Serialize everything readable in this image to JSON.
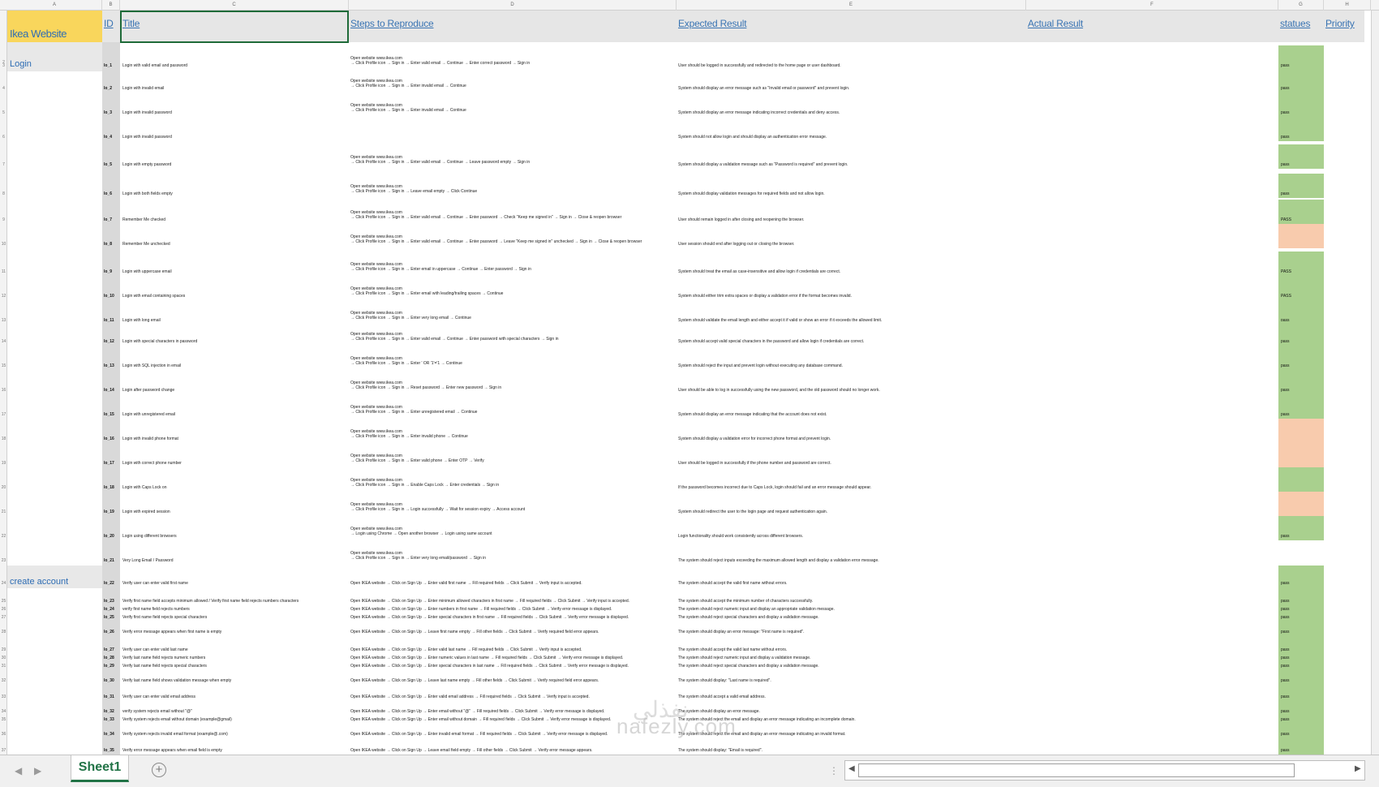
{
  "columns": {
    "letters": [
      "A",
      "B",
      "C",
      "D",
      "E",
      "F",
      "G",
      "H"
    ],
    "headers": {
      "module": "Ikea Website",
      "id": "ID",
      "title": "Title",
      "steps": "Steps to Reproduce",
      "expected": "Expected Result",
      "actual": "Actual Result",
      "status": "statues",
      "priority": "Priority"
    }
  },
  "modules": [
    "Login",
    "create account"
  ],
  "login_rows": [
    {
      "id": "lo_1",
      "title": "Login with valid email and password",
      "steps": [
        "Open website www.ikea.com",
        "→ Click Profile icon → Sign in → Enter valid email → Continue → Enter correct password → Sign in"
      ],
      "expected": "User should be logged in successfully and redirected to the home page or user dashboard.",
      "status": "pass",
      "fill": "green"
    },
    {
      "id": "lo_2",
      "title": "Login with invalid email",
      "steps": [
        "Open website www.ikea.com",
        "→ Click Profile icon → Sign in → Enter invalid email → Continue"
      ],
      "expected": "System should display an error message such as \"Invalid email or password\" and prevent login.",
      "status": "pass",
      "fill": "green"
    },
    {
      "id": "lo_3",
      "title": "Login with invalid password",
      "steps": [
        "Open website www.ikea.com",
        "→ Click Profile icon → Sign in → Enter invalid email → Continue"
      ],
      "expected": "System should display an error message indicating incorrect credentials and deny access.",
      "status": "pass",
      "fill": "green"
    },
    {
      "id": "lo_4",
      "title": "Login with invalid password",
      "steps": [
        ""
      ],
      "expected": "System should not allow login and should display an authentication error message.",
      "status": "pass",
      "fill": "green"
    },
    {
      "id": "lo_5",
      "title": "Login with empty password",
      "steps": [
        "Open website www.ikea.com",
        "→ Click Profile icon → Sign in → Enter valid email → Continue → Leave password empty → Sign in"
      ],
      "expected": "System should display a validation message such as \"Password is required\" and prevent login.",
      "status": "pass",
      "fill": "green"
    },
    {
      "id": "lo_6",
      "title": "Login with both fields empty",
      "steps": [
        "Open website www.ikea.com",
        "→ Click Profile icon → Sign in → Leave email empty → Click Continue"
      ],
      "expected": "System should display validation messages for required fields and not allow login.",
      "status": "pass",
      "fill": "green"
    },
    {
      "id": "lo_7",
      "title": "Remember Me checked",
      "steps": [
        "Open website www.ikea.com",
        "→ Click Profile icon → Sign in → Enter valid email → Continue → Enter password → Check \"Keep me signed in\" → Sign in → Close & reopen browser"
      ],
      "expected": "User should remain logged in after closing and reopening the browser.",
      "status": "PASS",
      "fill": "green"
    },
    {
      "id": "lo_8",
      "title": "Remember Me unchecked",
      "steps": [
        "Open website www.ikea.com",
        "→ Click Profile icon → Sign in → Enter valid email → Continue → Enter password → Leave \"Keep me signed in\" unchecked → Sign in → Close & reopen browser"
      ],
      "expected": "User session should end after logging out or closing the browser.",
      "status": "",
      "fill": "orange"
    },
    {
      "id": "lo_9",
      "title": "Login with uppercase email",
      "steps": [
        "Open website www.ikea.com",
        "→ Click Profile icon → Sign in → Enter email in uppercase → Continue → Enter password → Sign in"
      ],
      "expected": "System should treat the email as case-insensitive and allow login if credentials are correct.",
      "status": "PASS",
      "fill": "green"
    },
    {
      "id": "lo_10",
      "title": "Login with email containing spaces",
      "steps": [
        "Open website www.ikea.com",
        "→ Click Profile icon → Sign in → Enter email with leading/trailing spaces → Continue"
      ],
      "expected": "System should either trim extra spaces or display a validation error if the format becomes invalid.",
      "status": "PASS",
      "fill": "green"
    },
    {
      "id": "lo_11",
      "title": "Login with long email",
      "steps": [
        "Open website www.ikea.com",
        "→ Click Profile icon → Sign in → Enter very long email → Continue"
      ],
      "expected": "System should validate the email length and either accept it if valid or show an error if it exceeds the allowed limit.",
      "status": "pass",
      "fill": "green"
    },
    {
      "id": "lo_12",
      "title": "Login with special characters in password",
      "steps": [
        "Open website www.ikea.com",
        "→ Click Profile icon → Sign in → Enter valid email → Continue → Enter password with special characters → Sign in"
      ],
      "expected": "System should accept valid special characters in the password and allow login if credentials are correct.",
      "status": "pass",
      "fill": "green"
    },
    {
      "id": "lo_13",
      "title": "Login with SQL injection in email",
      "steps": [
        "Open website www.ikea.com",
        "→ Click Profile icon → Sign in → Enter ' OR '1'='1 → Continue"
      ],
      "expected": "System should reject the input and prevent login without executing any database command.",
      "status": "pass",
      "fill": "green"
    },
    {
      "id": "lo_14",
      "title": "Login after password change",
      "steps": [
        "Open website www.ikea.com",
        "→ Click Profile icon → Sign in → Reset password → Enter new password → Sign in"
      ],
      "expected": "User should be able to log in successfully using the new password, and the old password should no longer work.",
      "status": "pass",
      "fill": "green"
    },
    {
      "id": "lo_15",
      "title": "Login with unregistered email",
      "steps": [
        "Open website www.ikea.com",
        "→ Click Profile icon → Sign in → Enter unregistered email → Continue"
      ],
      "expected": "System should display an error message indicating that the account does not exist.",
      "status": "pass",
      "fill": "green"
    },
    {
      "id": "lo_16",
      "title": "Login with invalid phone format",
      "steps": [
        "Open website www.ikea.com",
        "→ Click Profile icon → Sign in → Enter invalid phone → Continue"
      ],
      "expected": "System should display a validation error for incorrect phone format and prevent login.",
      "status": "",
      "fill": "orange"
    },
    {
      "id": "lo_17",
      "title": "Login with correct phone number",
      "steps": [
        "Open website www.ikea.com",
        "→ Click Profile icon → Sign in → Enter valid phone → Enter OTP → Verify"
      ],
      "expected": "User should be logged in successfully if the phone number and password are correct.",
      "status": "",
      "fill": "orange"
    },
    {
      "id": "lo_18",
      "title": "Login with Caps Lock on",
      "steps": [
        "Open website www.ikea.com",
        "→ Click Profile icon → Sign in → Enable Caps Lock → Enter credentials → Sign in"
      ],
      "expected": "If the password becomes incorrect due to Caps Lock, login should fail and an error message should appear.",
      "status": "",
      "fill": "green"
    },
    {
      "id": "lo_19",
      "title": "Login with expired session",
      "steps": [
        "Open website www.ikea.com",
        "→ Click Profile icon → Sign in → Login successfully → Wait for session expiry → Access account"
      ],
      "expected": "System should redirect the user to the login page and request authentication again.",
      "status": "",
      "fill": "orange"
    },
    {
      "id": "lo_20",
      "title": "Login using different browsers",
      "steps": [
        "Open website www.ikea.com",
        "→ Login using Chrome → Open another browser → Login using same account"
      ],
      "expected": "Login functionality should work consistently across different browsers.",
      "status": "pass",
      "fill": "green"
    },
    {
      "id": "lo_21",
      "title": "Very Long Email / Password",
      "steps": [
        "Open website www.ikea.com",
        "→ Click Profile icon → Sign in → Enter very long email/password → Sign in"
      ],
      "expected": "The system should reject inputs exceeding the maximum allowed length and display a validation error message.",
      "status": "",
      "fill": "none"
    }
  ],
  "account_rows": [
    {
      "id": "lo_22",
      "title": "Verify user can enter valid first name",
      "steps": "Open IKEA website → Click on Sign Up → Enter valid first name → Fill required fields → Click Submit → Verify input is accepted.",
      "expected": "The system should accept the valid first name without errors.",
      "status": "pass"
    },
    {
      "id": "lo_23",
      "title": "Verify first name field accepts minimum allowed / Verify first name field rejects numbers characters",
      "steps": "Open IKEA website → Click on Sign Up → Enter minimum allowed characters in first name → Fill required fields → Click Submit → Verify input is accepted.",
      "expected": "The system should accept the minimum number of characters successfully.",
      "status": "pass"
    },
    {
      "id": "lo_24",
      "title": "verify first name field rejects numbers",
      "steps": "Open IKEA website → Click on Sign Up → Enter numbers in first name → Fill required fields → Click Submit → Verify error message is displayed.",
      "expected": "The system should reject numeric input and display an appropriate validation message.",
      "status": "pass"
    },
    {
      "id": "lo_25",
      "title": "Verify first name field rejects special characters",
      "steps": "Open IKEA website → Click on Sign Up → Enter special characters in first name → Fill required fields → Click Submit → Verify error message is displayed.",
      "expected": "The system should reject special characters and display a validation message.",
      "status": "pass"
    },
    {
      "id": "lo_26",
      "title": "Verify error message appears when first name is empty",
      "steps": "Open IKEA website → Click on Sign Up → Leave first name empty → Fill other fields → Click Submit → Verify required field error appears.",
      "expected": "The system should display an error message: \"First name is required\".",
      "status": "pass"
    },
    {
      "id": "lo_27",
      "title": "Verify user can enter valid last name",
      "steps": "Open IKEA website → Click on Sign Up → Enter valid last name → Fill required fields → Click Submit → Verify input is accepted.",
      "expected": "The system should accept the valid last name without errors.",
      "status": "pass"
    },
    {
      "id": "lo_28",
      "title": "Verify last name field rejects numeric numbers",
      "steps": "Open IKEA website → Click on Sign Up → Enter numeric values in last name → Fill required fields → Click Submit → Verify error message is displayed.",
      "expected": "The system should reject numeric input and display a validation message.",
      "status": "pass"
    },
    {
      "id": "lo_29",
      "title": "Verify last name field rejects special characters",
      "steps": "Open IKEA website → Click on Sign Up → Enter special characters in last name → Fill required fields → Click Submit → Verify error message is displayed.",
      "expected": "The system should reject special characters and display a validation message.",
      "status": "pass"
    },
    {
      "id": "lo_30",
      "title": "Verify last name field shows validation message when empty",
      "steps": "Open IKEA website → Click on Sign Up → Leave last name empty → Fill other fields → Click Submit → Verify required field error appears.",
      "expected": "The system should display: \"Last name is required\".",
      "status": "pass"
    },
    {
      "id": "lo_31",
      "title": "Verify user can enter valid email address",
      "steps": "Open IKEA website → Click on Sign Up → Enter valid email address → Fill required fields → Click Submit → Verify input is accepted.",
      "expected": "The system should accept a valid email address.",
      "status": "pass"
    },
    {
      "id": "lo_32",
      "title": "verify system rejects email without \"@\"",
      "steps": "Open IKEA website → Click on Sign Up → Enter email without \"@\" → Fill required fields → Click Submit → Verify error message is displayed.",
      "expected": "The system should display an error message.",
      "status": "pass"
    },
    {
      "id": "lo_33",
      "title": "Verify system rejects email without domain (example@gmail)",
      "steps": "Open IKEA website → Click on Sign Up → Enter email without domain → Fill required fields → Click Submit → Verify error message is displayed.",
      "expected": "The system should reject the email and display an error message indicating an incomplete domain.",
      "status": "pass"
    },
    {
      "id": "lo_34",
      "title": "Verify system rejects invalid email format (example@.com)",
      "steps": "Open IKEA website → Click on Sign Up → Enter invalid email format → Fill required fields → Click Submit → Verify error message is displayed.",
      "expected": "The system should reject the email and display an error message indicating an invalid format.",
      "status": "pass"
    },
    {
      "id": "lo_35",
      "title": "Verify error message appears when email field is empty",
      "steps": "Open IKEA website → Click on Sign Up → Leave email field empty → Fill other fields → Click Submit → Verify error message appears.",
      "expected": "The system should display: \"Email is required\".",
      "status": "pass"
    }
  ],
  "tabs": {
    "sheet_name": "Sheet1",
    "add_label": "+"
  },
  "watermark": {
    "latin": "nafezly.com",
    "arabic": "نفذلي"
  },
  "colors": {
    "pass_fill": "#a9d08e",
    "fail_fill": "#f8cbad",
    "header_link": "#3a74b3",
    "module_header_fill": "#f9d65c",
    "selection": "#1f6b39",
    "sheet_tab": "#217346"
  }
}
